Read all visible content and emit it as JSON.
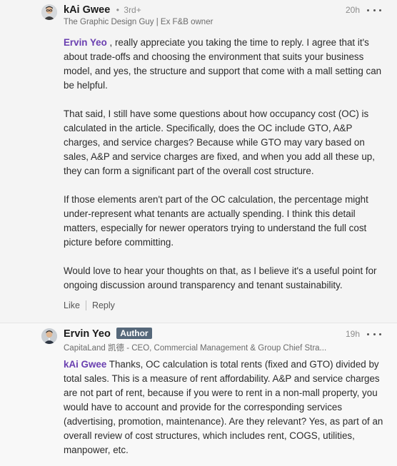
{
  "comment1": {
    "author_name": "kAi Gwee",
    "dot": "•",
    "degree": "3rd+",
    "headline": "The Graphic Design Guy | Ex F&B owner",
    "time": "20h",
    "mention": "Ervin Yeo",
    "para1_rest": " , really appreciate you taking the time to reply. I agree that it's about trade-offs and choosing the environment that suits your business model, and yes, the structure and support that come with a mall setting can be helpful.",
    "para2": "That said, I still have some questions about how occupancy cost (OC) is calculated in the article. Specifically, does the OC include GTO, A&P charges, and service charges? Because while GTO may vary based on sales, A&P and service charges are fixed, and when you add all these up, they can form a significant part of the overall cost structure.",
    "para3": "If those elements aren't part of the OC calculation, the percentage might under-represent what tenants are actually spending. I think this detail matters, especially for newer operators trying to understand the full cost picture before committing.",
    "para4": "Would love to hear your thoughts on that, as I believe it's a useful point for ongoing discussion around transparency and tenant sustainability.",
    "like_label": "Like",
    "reply_label": "Reply"
  },
  "comment2": {
    "author_name": "Ervin Yeo",
    "badge": "Author",
    "headline": "CapitaLand 凯德 - CEO, Commercial Management & Group Chief Stra...",
    "time": "19h",
    "mention": "kAi Gwee",
    "para1_rest": " Thanks, OC calculation is total rents (fixed and GTO) divided by total sales. This is a measure of rent affordability. A&P and service charges are not part of rent, because if you were to rent in a non-mall property, you would have to account and provide for the corresponding services (advertising, promotion, maintenance). Are they relevant? Yes, as part of an overall review of cost structures, which includes rent, COGS, utilities, manpower, etc."
  }
}
